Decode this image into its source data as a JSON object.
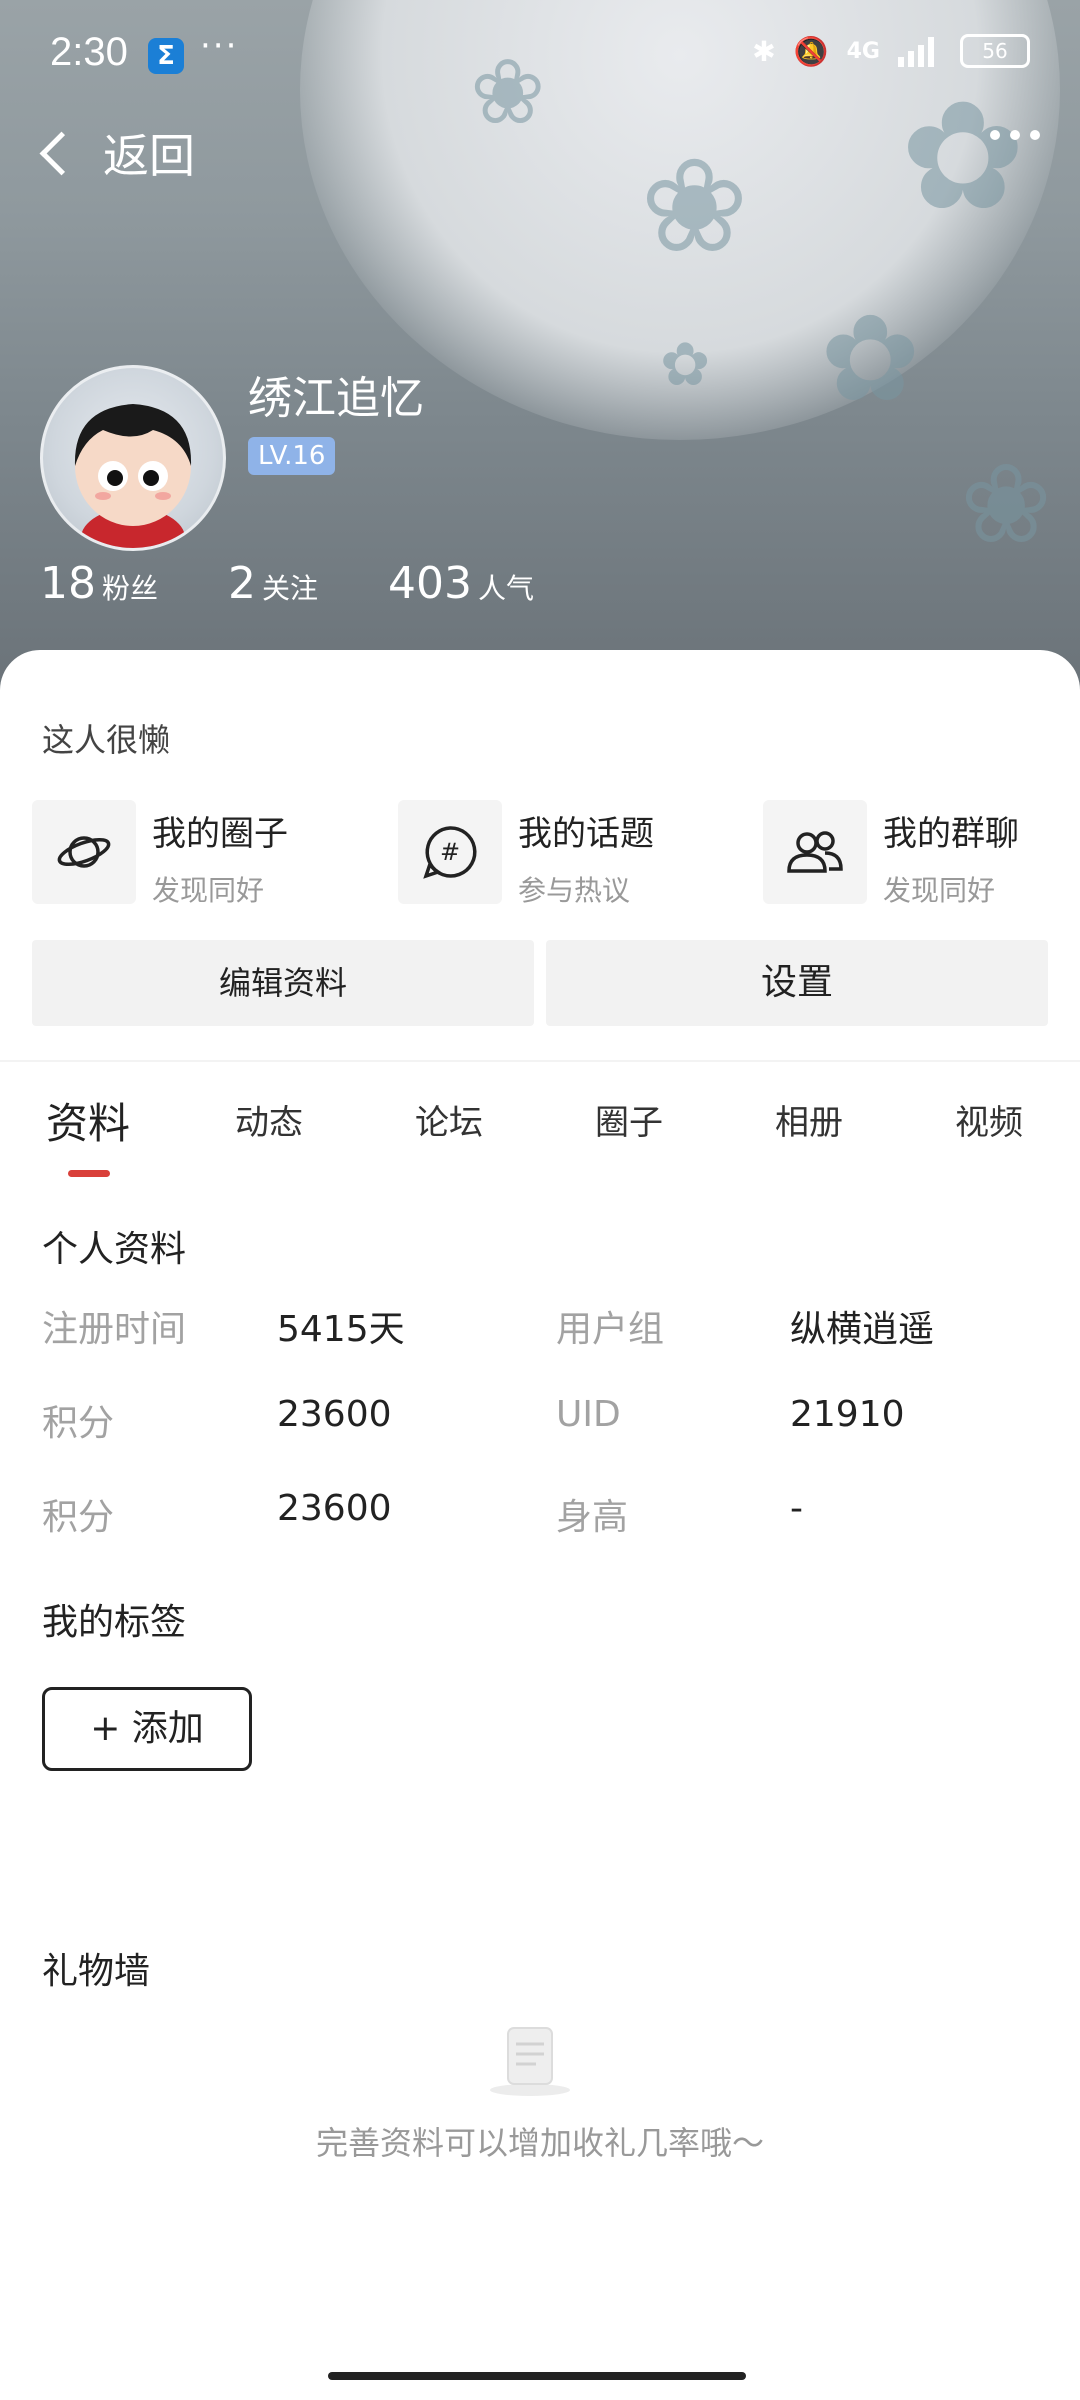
{
  "status_bar": {
    "time": "2:30",
    "battery": "56",
    "network": "4G"
  },
  "nav": {
    "back_label": "返回"
  },
  "profile": {
    "username": "绣江追忆",
    "level": "LV.16",
    "stats": [
      {
        "value": "18",
        "label": "粉丝"
      },
      {
        "value": "2",
        "label": "关注"
      },
      {
        "value": "403",
        "label": "人气"
      }
    ],
    "bio": "这人很懒"
  },
  "quick_links": [
    {
      "title": "我的圈子",
      "subtitle": "发现同好",
      "icon": "planet-icon"
    },
    {
      "title": "我的话题",
      "subtitle": "参与热议",
      "icon": "hashtag-bubble-icon"
    },
    {
      "title": "我的群聊",
      "subtitle": "发现同好",
      "icon": "group-users-icon"
    }
  ],
  "buttons": {
    "edit_profile": "编辑资料",
    "settings": "设置"
  },
  "tabs": [
    "资料",
    "动态",
    "论坛",
    "圈子",
    "相册",
    "视频"
  ],
  "active_tab": "资料",
  "personal_info": {
    "title": "个人资料",
    "rows": [
      {
        "label1": "注册时间",
        "value1": "5415天",
        "label2": "用户组",
        "value2": "纵横逍遥"
      },
      {
        "label1": "积分",
        "value1": "23600",
        "label2": "UID",
        "value2": "21910"
      },
      {
        "label1": "积分",
        "value1": "23600",
        "label2": "身高",
        "value2": "-"
      }
    ]
  },
  "tags": {
    "title": "我的标签",
    "add_label": "+ 添加"
  },
  "gift_wall": {
    "title": "礼物墙",
    "empty_text": "完善资料可以增加收礼几率哦～"
  },
  "colors": {
    "accent": "#d9403a",
    "level_badge": "#8fb3e8"
  }
}
